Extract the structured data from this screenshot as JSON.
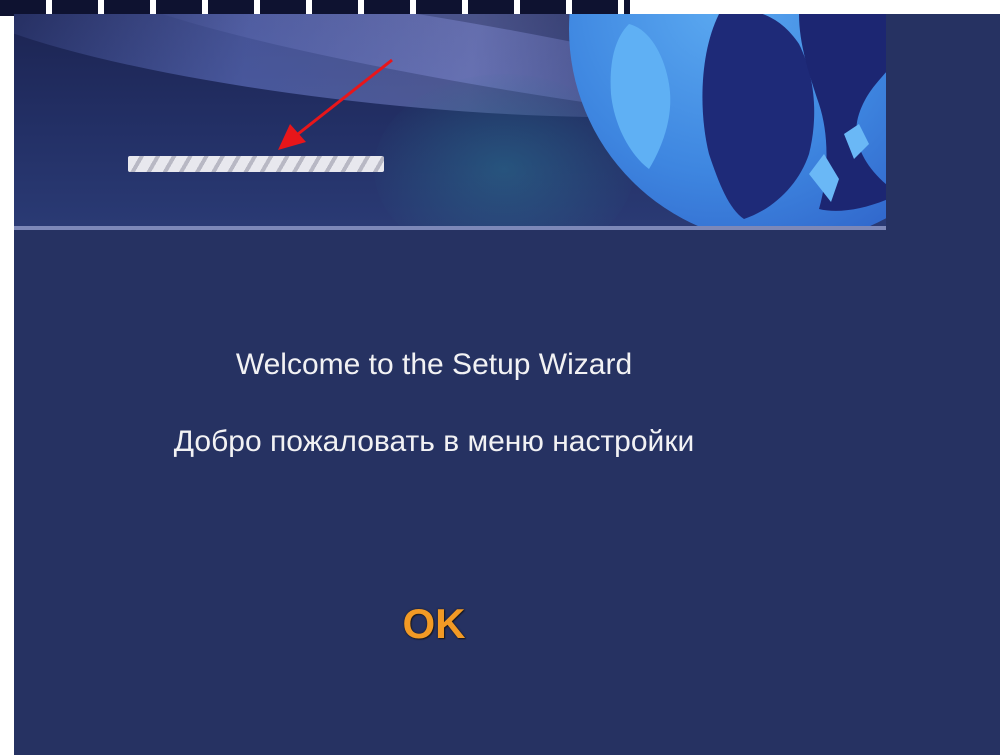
{
  "wizard": {
    "welcome_text_en": "Welcome to the Setup Wizard",
    "welcome_text_ru": "Добро пожаловать в меню настройки",
    "ok_label": "OK"
  },
  "colors": {
    "background": "#263262",
    "text": "#f2f2f4",
    "ok_accent": "#f29a25",
    "annotation_arrow": "#e8161a"
  }
}
